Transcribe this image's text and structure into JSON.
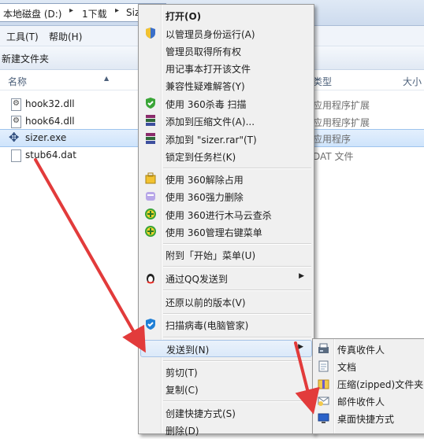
{
  "address": {
    "crumbs": [
      "本地磁盘 (D:)",
      "1下载",
      "Siz"
    ]
  },
  "menubar": {
    "items": [
      "工具(T)",
      "帮助(H)"
    ]
  },
  "toolbar": {
    "new_folder": "新建文件夹"
  },
  "columns": {
    "name": "名称",
    "type": "类型",
    "size": "大小"
  },
  "files": [
    {
      "name": "hook32.dll",
      "type": "应用程序扩展",
      "icon": "dll-icon",
      "selected": false
    },
    {
      "name": "hook64.dll",
      "type": "应用程序扩展",
      "icon": "dll-icon",
      "selected": false
    },
    {
      "name": "sizer.exe",
      "type": "应用程序",
      "icon": "move-icon",
      "selected": true
    },
    {
      "name": "stub64.dat",
      "type": "DAT 文件",
      "icon": "file-icon",
      "selected": false
    }
  ],
  "context_menu": {
    "items": [
      {
        "label": "打开(O)",
        "icon": "",
        "bold": true
      },
      {
        "label": "以管理员身份运行(A)",
        "icon": "uac-shield-icon"
      },
      {
        "label": "管理员取得所有权",
        "icon": ""
      },
      {
        "label": "用记事本打开该文件",
        "icon": ""
      },
      {
        "label": "兼容性疑难解答(Y)",
        "icon": ""
      },
      {
        "label": "使用 360杀毒 扫描",
        "icon": "360-antivirus-icon"
      },
      {
        "label": "添加到压缩文件(A)...",
        "icon": "winrar-icon"
      },
      {
        "label": "添加到 \"sizer.rar\"(T)",
        "icon": "winrar-icon"
      },
      {
        "label": "锁定到任务栏(K)",
        "icon": ""
      },
      {
        "label": "使用 360解除占用",
        "icon": "360-unlock-icon"
      },
      {
        "label": "使用 360强力删除",
        "icon": "360-shred-icon"
      },
      {
        "label": "使用 360进行木马云查杀",
        "icon": "360-plus-icon"
      },
      {
        "label": "使用 360管理右键菜单",
        "icon": "360-plus-icon"
      },
      {
        "label": "附到「开始」菜单(U)",
        "icon": ""
      },
      {
        "label": "通过QQ发送到",
        "icon": "qq-penguin-icon"
      },
      {
        "label": "还原以前的版本(V)",
        "icon": ""
      },
      {
        "label": "扫描病毒(电脑管家)",
        "icon": "tencent-shield-icon"
      },
      {
        "label": "发送到(N)",
        "icon": ""
      },
      {
        "label": "剪切(T)",
        "icon": ""
      },
      {
        "label": "复制(C)",
        "icon": ""
      },
      {
        "label": "创建快捷方式(S)",
        "icon": ""
      },
      {
        "label": "删除(D)",
        "icon": ""
      }
    ]
  },
  "send_to_menu": {
    "items": [
      {
        "label": "传真收件人",
        "icon": "fax-icon"
      },
      {
        "label": "文档",
        "icon": "documents-icon"
      },
      {
        "label": "压缩(zipped)文件夹",
        "icon": "zip-folder-icon"
      },
      {
        "label": "邮件收件人",
        "icon": "mail-icon"
      },
      {
        "label": "桌面快捷方式",
        "icon": "desktop-icon"
      }
    ]
  },
  "colors": {
    "arrow": "#e23b3b",
    "highlight": "#dbe9f9",
    "selection": "#cfe4fb"
  }
}
